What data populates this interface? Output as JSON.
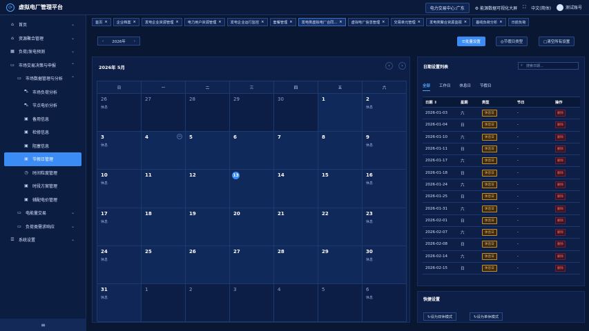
{
  "app": {
    "title": "虚拟电厂管理平台",
    "logo_glyph": "⟳"
  },
  "header": {
    "trading_center": "电力交易中心:广东",
    "energy_tag": "能源数据可视化大屏",
    "language": "中文(简体)",
    "user": "测试账号",
    "fullscreen_glyph": "⛶",
    "settings_glyph": "⚙"
  },
  "sidebar": {
    "items": [
      {
        "label": "首页",
        "icon": "home-icon",
        "glyph": "⌂",
        "level": 1,
        "chevron": "⌄"
      },
      {
        "label": "资源聚合管理",
        "icon": "home-icon",
        "glyph": "⌂",
        "level": 1,
        "chevron": "⌄"
      },
      {
        "label": "负荷/发电预测",
        "icon": "chart-icon",
        "glyph": "▦",
        "level": 1,
        "chevron": "⌄"
      },
      {
        "label": "市场交易决策与申报",
        "icon": "monitor-icon",
        "glyph": "▭",
        "level": 1,
        "chevron": "⌃"
      },
      {
        "label": "市场数据管理与分析",
        "icon": "monitor-icon",
        "glyph": "▭",
        "level": 2,
        "chevron": "⌃"
      },
      {
        "label": "市场负荷分析",
        "icon": "cart-icon",
        "glyph": "⛍",
        "level": 3
      },
      {
        "label": "节点电价分析",
        "icon": "cart-icon",
        "glyph": "⛍",
        "level": 3
      },
      {
        "label": "备用信息",
        "icon": "document-icon",
        "glyph": "▣",
        "level": 3
      },
      {
        "label": "检修信息",
        "icon": "document-icon",
        "glyph": "▣",
        "level": 3
      },
      {
        "label": "阻塞信息",
        "icon": "document-icon",
        "glyph": "▣",
        "level": 3
      },
      {
        "label": "节假日管理",
        "icon": "document-icon",
        "glyph": "▣",
        "level": 3,
        "active": true
      },
      {
        "label": "时间粒度管理",
        "icon": "clock-icon",
        "glyph": "◷",
        "level": 3
      },
      {
        "label": "时段方案管理",
        "icon": "document-icon",
        "glyph": "▣",
        "level": 3
      },
      {
        "label": "辅配电价管理",
        "icon": "document-icon",
        "glyph": "▣",
        "level": 3
      },
      {
        "label": "电能量交易",
        "icon": "monitor-icon",
        "glyph": "▭",
        "level": 2,
        "chevron": "⌄"
      },
      {
        "label": "负荷类需求响应",
        "icon": "monitor-icon",
        "glyph": "▭",
        "level": 2,
        "chevron": "⌄"
      },
      {
        "label": "系统设置",
        "icon": "sliders-icon",
        "glyph": "☰",
        "level": 1,
        "chevron": "⌄"
      }
    ],
    "collapse_glyph": "≡"
  },
  "tabs": [
    {
      "label": "首页",
      "close": "×"
    },
    {
      "label": "企业档案",
      "close": "×"
    },
    {
      "label": "发电企业资源管理",
      "close": "×"
    },
    {
      "label": "电力用户资源管理",
      "close": "×"
    },
    {
      "label": "发电企业运行监控",
      "close": "×"
    },
    {
      "label": "套餐管理",
      "close": "×"
    },
    {
      "label": "发电类虚拟电厂合同...",
      "close": "×",
      "active": true
    },
    {
      "label": "虚拟电厂信息管理",
      "close": "×"
    },
    {
      "label": "交易单元管理",
      "close": "×"
    },
    {
      "label": "发电类聚合资源监视",
      "close": "×"
    },
    {
      "label": "基线负荷分析",
      "close": "×"
    },
    {
      "label": "日前负荷",
      "close": ""
    }
  ],
  "toolbar": {
    "year": "2026年",
    "prev": "‹",
    "next": "›",
    "batch": "☰批量设置",
    "type": "◎节假日类型",
    "clear": "▢清空所有设置"
  },
  "calendar": {
    "title": "2026年 5月",
    "prev": "‹",
    "next": "›",
    "weekdays": [
      "日",
      "一",
      "二",
      "三",
      "四",
      "五",
      "六"
    ],
    "weeks": [
      [
        {
          "d": "26",
          "o": 1,
          "h": "休息"
        },
        {
          "d": "27",
          "o": 1
        },
        {
          "d": "28",
          "o": 1
        },
        {
          "d": "29",
          "o": 1
        },
        {
          "d": "30",
          "o": 1
        },
        {
          "d": "1"
        },
        {
          "d": "2",
          "h": "休息"
        }
      ],
      [
        {
          "d": "3",
          "h": "休息"
        },
        {
          "d": "4",
          "mini": "−"
        },
        {
          "d": "5"
        },
        {
          "d": "6"
        },
        {
          "d": "7"
        },
        {
          "d": "8"
        },
        {
          "d": "9",
          "h": "休息"
        }
      ],
      [
        {
          "d": "10",
          "h": "休息"
        },
        {
          "d": "11"
        },
        {
          "d": "12"
        },
        {
          "d": "13",
          "today": 1
        },
        {
          "d": "14"
        },
        {
          "d": "15"
        },
        {
          "d": "16",
          "h": "休息"
        }
      ],
      [
        {
          "d": "17",
          "h": "休息"
        },
        {
          "d": "18"
        },
        {
          "d": "19"
        },
        {
          "d": "20"
        },
        {
          "d": "21"
        },
        {
          "d": "22"
        },
        {
          "d": "23",
          "h": "休息"
        }
      ],
      [
        {
          "d": "24",
          "h": "休息"
        },
        {
          "d": "25"
        },
        {
          "d": "26"
        },
        {
          "d": "27"
        },
        {
          "d": "28"
        },
        {
          "d": "29"
        },
        {
          "d": "30",
          "h": "休息"
        }
      ],
      [
        {
          "d": "31",
          "h": "休息"
        },
        {
          "d": "1",
          "o": 1
        },
        {
          "d": "2",
          "o": 1
        },
        {
          "d": "3",
          "o": 1
        },
        {
          "d": "4",
          "o": 1
        },
        {
          "d": "5",
          "o": 1
        },
        {
          "d": "6",
          "o": 1,
          "h": "休息"
        }
      ]
    ]
  },
  "list": {
    "title": "日期设置列表",
    "search_placeholder": "搜索日期...",
    "search_glyph": "⌕",
    "tabs": [
      "全部",
      "工作日",
      "休息日",
      "节假日"
    ],
    "columns": [
      "日期 ⇕",
      "星期",
      "类型",
      "节日",
      "操作"
    ],
    "rows": [
      [
        "2026-01-03",
        "六",
        "休息日",
        "-",
        "删除"
      ],
      [
        "2026-01-04",
        "日",
        "休息日",
        "-",
        "删除"
      ],
      [
        "2026-01-10",
        "六",
        "休息日",
        "-",
        "删除"
      ],
      [
        "2026-01-11",
        "日",
        "休息日",
        "-",
        "删除"
      ],
      [
        "2026-01-17",
        "六",
        "休息日",
        "-",
        "删除"
      ],
      [
        "2026-01-18",
        "日",
        "休息日",
        "-",
        "删除"
      ],
      [
        "2026-01-24",
        "六",
        "休息日",
        "-",
        "删除"
      ],
      [
        "2026-01-25",
        "日",
        "休息日",
        "-",
        "删除"
      ],
      [
        "2026-01-31",
        "六",
        "休息日",
        "-",
        "删除"
      ],
      [
        "2026-02-01",
        "日",
        "休息日",
        "-",
        "删除"
      ],
      [
        "2026-02-07",
        "六",
        "休息日",
        "-",
        "删除"
      ],
      [
        "2026-02-08",
        "日",
        "休息日",
        "-",
        "删除"
      ],
      [
        "2026-02-14",
        "六",
        "休息日",
        "-",
        "删除"
      ],
      [
        "2026-02-15",
        "日",
        "休息日",
        "-",
        "删除"
      ]
    ]
  },
  "quick": {
    "title": "快捷设置",
    "btn1": "↻设为双休模式",
    "btn2": "↻设为单休模式"
  }
}
